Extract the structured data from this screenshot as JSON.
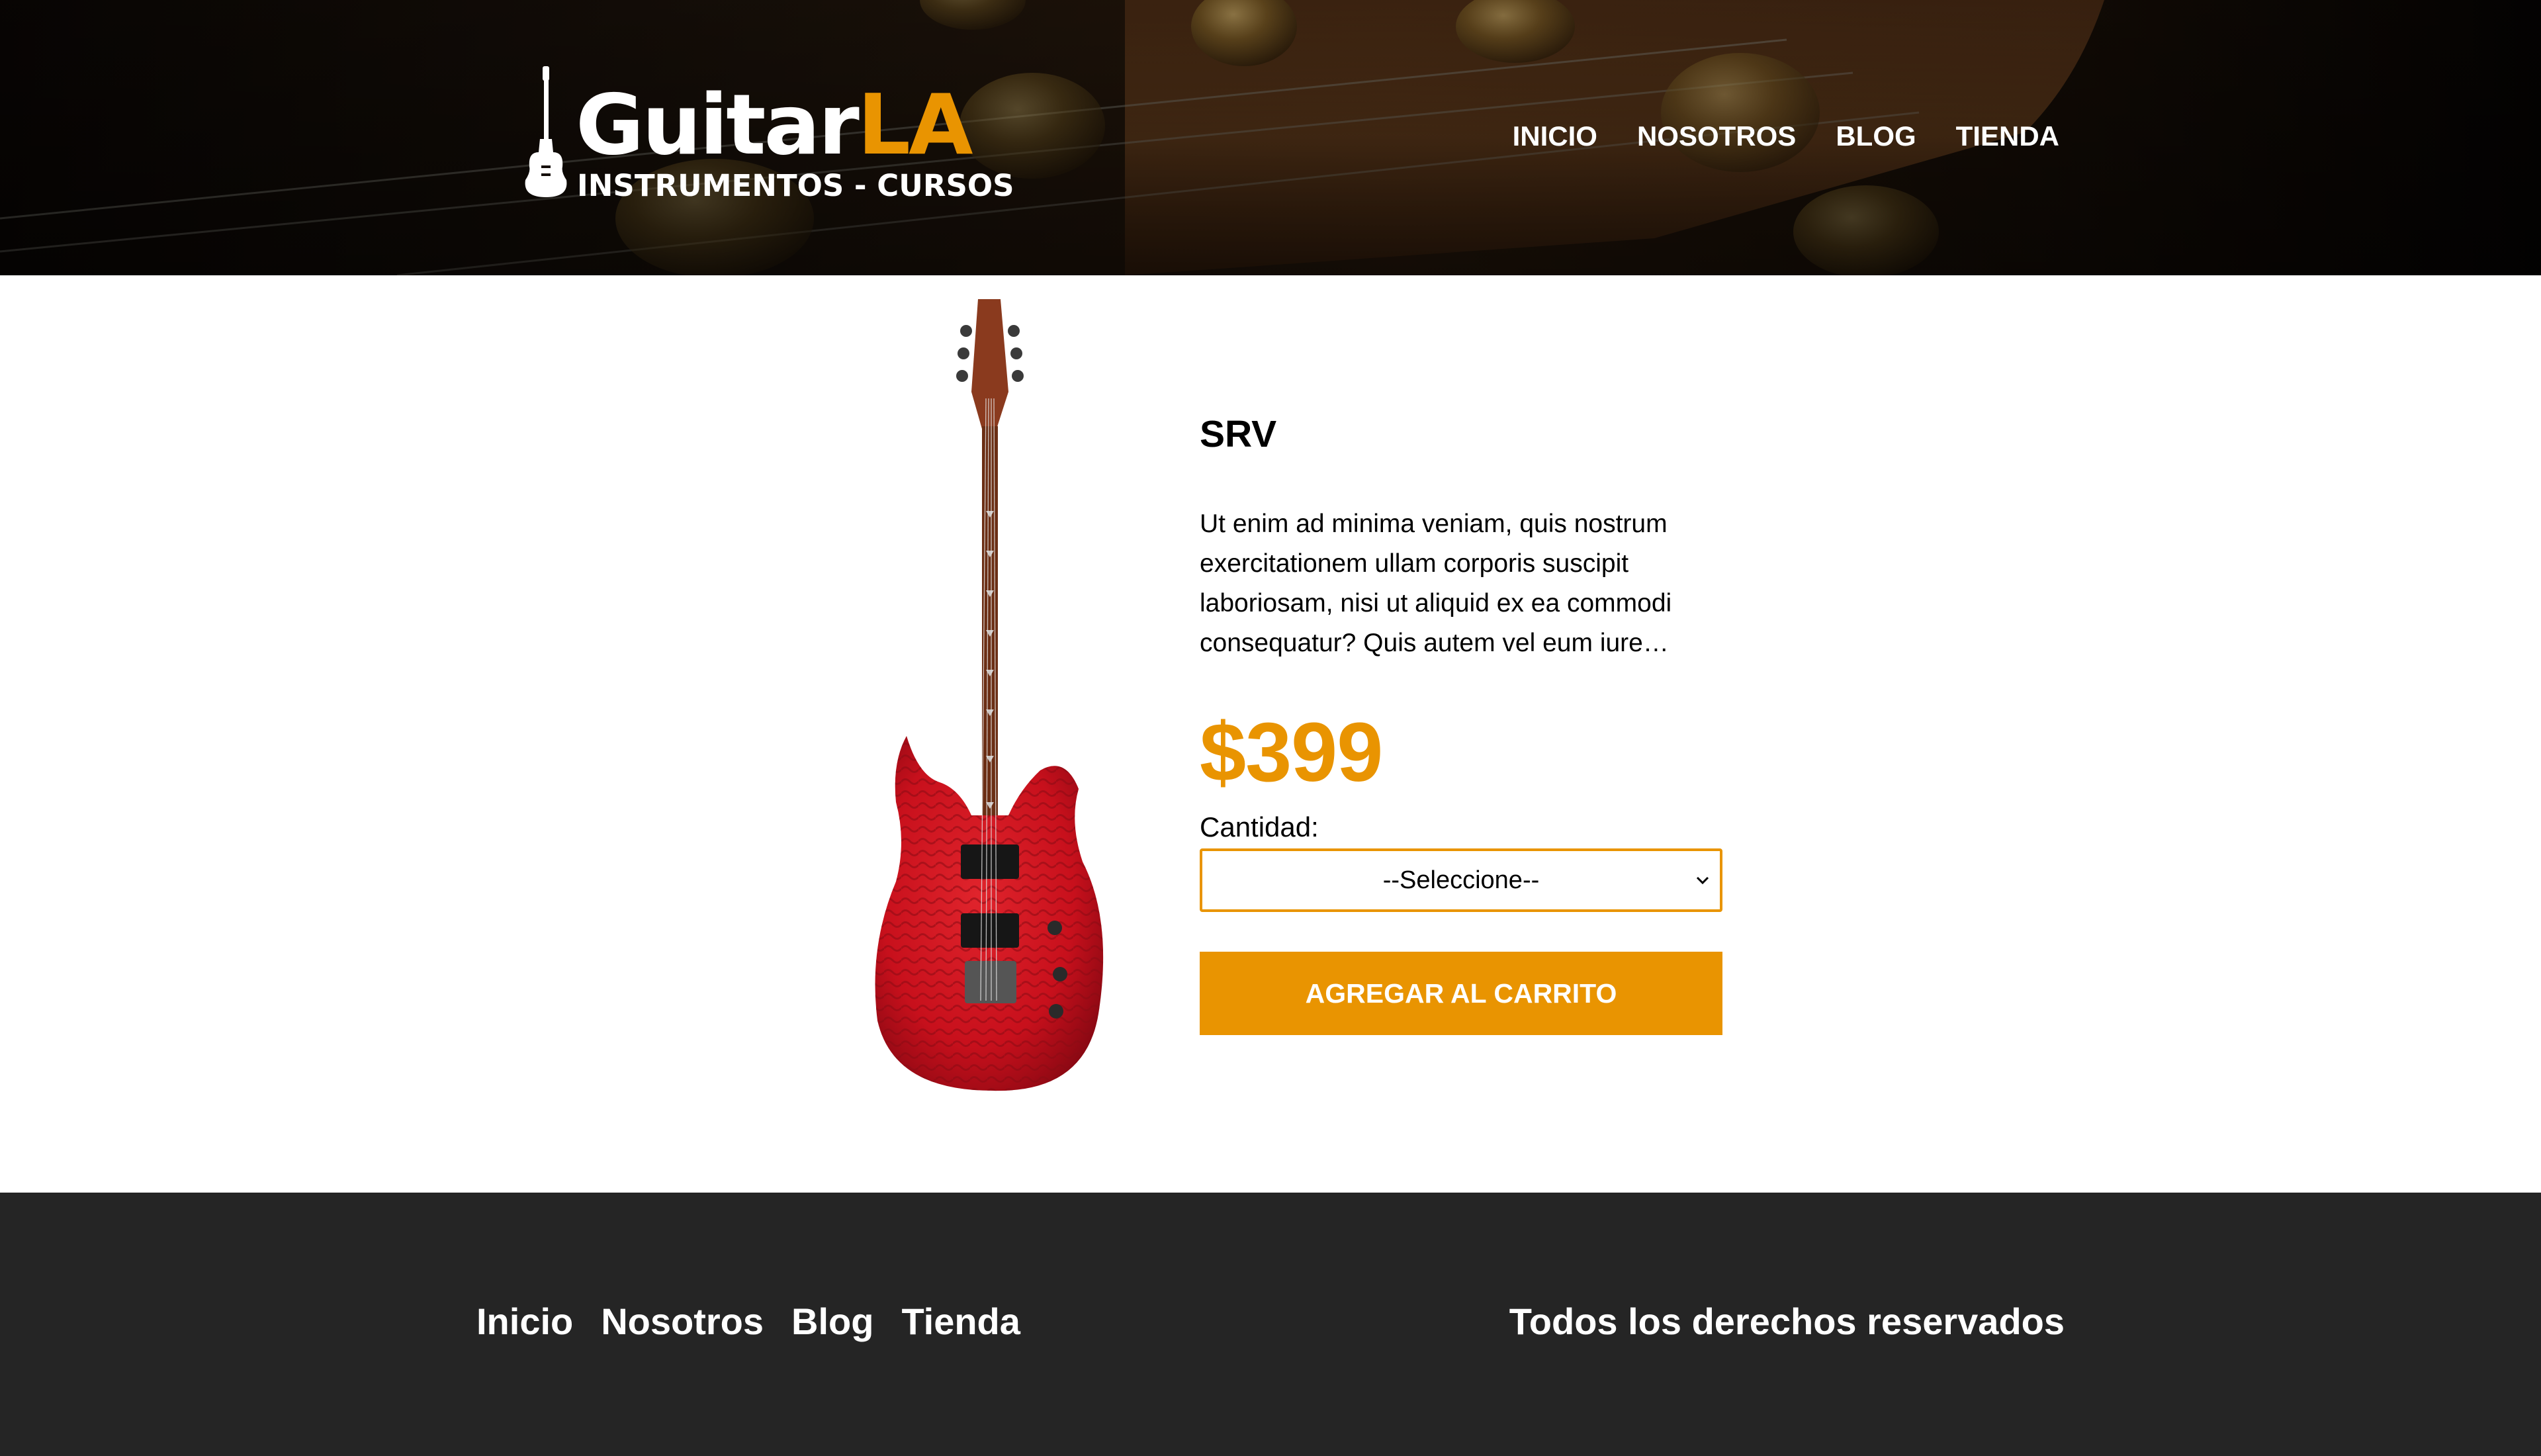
{
  "header": {
    "logo": {
      "brand_main": "Guitar",
      "brand_accent": "LA",
      "tagline": "INSTRUMENTOS - CURSOS"
    },
    "nav": [
      {
        "label": "INICIO"
      },
      {
        "label": "NOSOTROS"
      },
      {
        "label": "BLOG"
      },
      {
        "label": "TIENDA"
      }
    ]
  },
  "product": {
    "name": "SRV",
    "description": "Ut enim ad minima veniam, quis nostrum exercitationem ullam corporis suscipit laboriosam, nisi ut aliquid ex ea commodi consequatur? Quis autem vel eum iure…",
    "price": "$399",
    "quantity_label": "Cantidad:",
    "quantity_select": {
      "selected": "--Seleccione--"
    },
    "add_button_label": "AGREGAR AL CARRITO",
    "image_icon": "electric-guitar-icon"
  },
  "footer": {
    "nav": [
      {
        "label": "Inicio"
      },
      {
        "label": "Nosotros"
      },
      {
        "label": "Blog"
      },
      {
        "label": "Tienda"
      }
    ],
    "copyright": "Todos los derechos reservados"
  },
  "colors": {
    "accent": "#e99401",
    "footer_bg": "#252525",
    "header_bg": "#140d07",
    "guitar_body": "#c8101c"
  }
}
